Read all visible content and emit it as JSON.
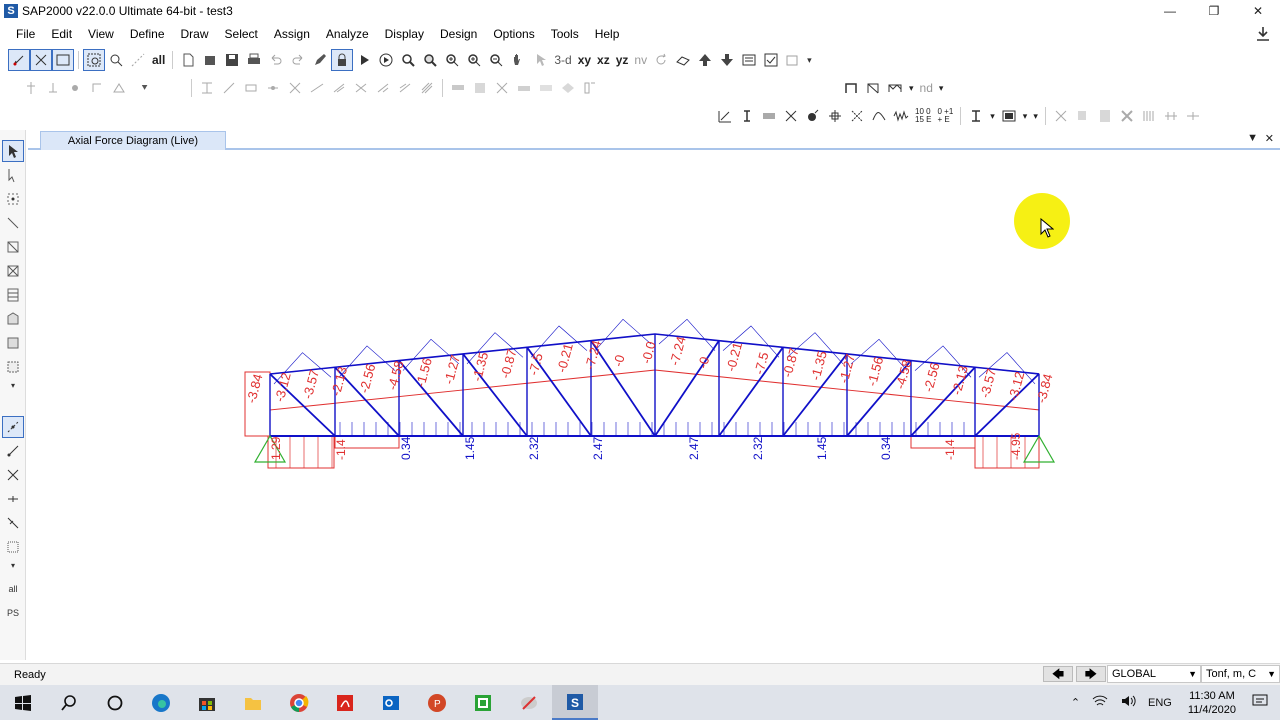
{
  "window": {
    "title": "SAP2000 v22.0.0 Ultimate 64-bit - test3",
    "app_badge": "S",
    "minimize_glyph": "—",
    "restore_glyph": "❐",
    "close_glyph": "✕"
  },
  "menu": {
    "items": [
      "File",
      "Edit",
      "View",
      "Define",
      "Draw",
      "Select",
      "Assign",
      "Analyze",
      "Display",
      "Design",
      "Options",
      "Tools",
      "Help"
    ]
  },
  "toolbar": {
    "view_3d": "3-d",
    "view_xy": "xy",
    "view_xz": "xz",
    "view_yz": "yz",
    "view_nv": "nv",
    "all_label": "all",
    "nd_label": "nd",
    "ten_label": "10 0\n15 E",
    "pm_label": "0 +1\n+ E"
  },
  "left_toolbar": {
    "all_label": "all",
    "ps_label": "PS"
  },
  "tab": {
    "label": "Axial Force Diagram (Live)",
    "dropdown_glyph": "▼",
    "close_glyph": "✕"
  },
  "diagram": {
    "top_labels": [
      "-3.84",
      "-3.12",
      "-3.57",
      "-2.13",
      "-2.56",
      "-4.58",
      "-1.56",
      "-1.27",
      "-1.35",
      "-0.87",
      "-7.5",
      "-0.21",
      "-7.24",
      "-0",
      "-0.0",
      "-7.24",
      "-0",
      "-0.21",
      "-7.5",
      "-0.87",
      "-1.35",
      "-1.27",
      "-1.56",
      "-4.58",
      "-2.56",
      "-2.13",
      "-3.57",
      "-3.12",
      "-3.84"
    ],
    "bottom_labels": [
      "1.29",
      "-1.4",
      "0.34",
      "1.45",
      "2.32",
      "2.47",
      "2.47",
      "2.32",
      "1.45",
      "0.34",
      "-1.4",
      "-4.95"
    ],
    "colors": {
      "frame": "#1010c8",
      "negative": "#e03030",
      "positive": "#e03030",
      "support": "#30b030",
      "highlight": "#f6f014"
    }
  },
  "status": {
    "ready": "Ready",
    "coord_system": "GLOBAL",
    "units": "Tonf, m, C",
    "prev_glyph": "🡄",
    "next_glyph": "🡆"
  },
  "taskbar": {
    "time": "11:30 AM",
    "date": "11/4/2020",
    "lang": "ENG",
    "tray_chevron": "⌃",
    "apps": [
      "windows-start",
      "search",
      "cortana",
      "edge",
      "store",
      "explorer",
      "chrome",
      "acrobat",
      "outlook",
      "powerpoint",
      "camtasia",
      "paint",
      "sap2000"
    ]
  }
}
